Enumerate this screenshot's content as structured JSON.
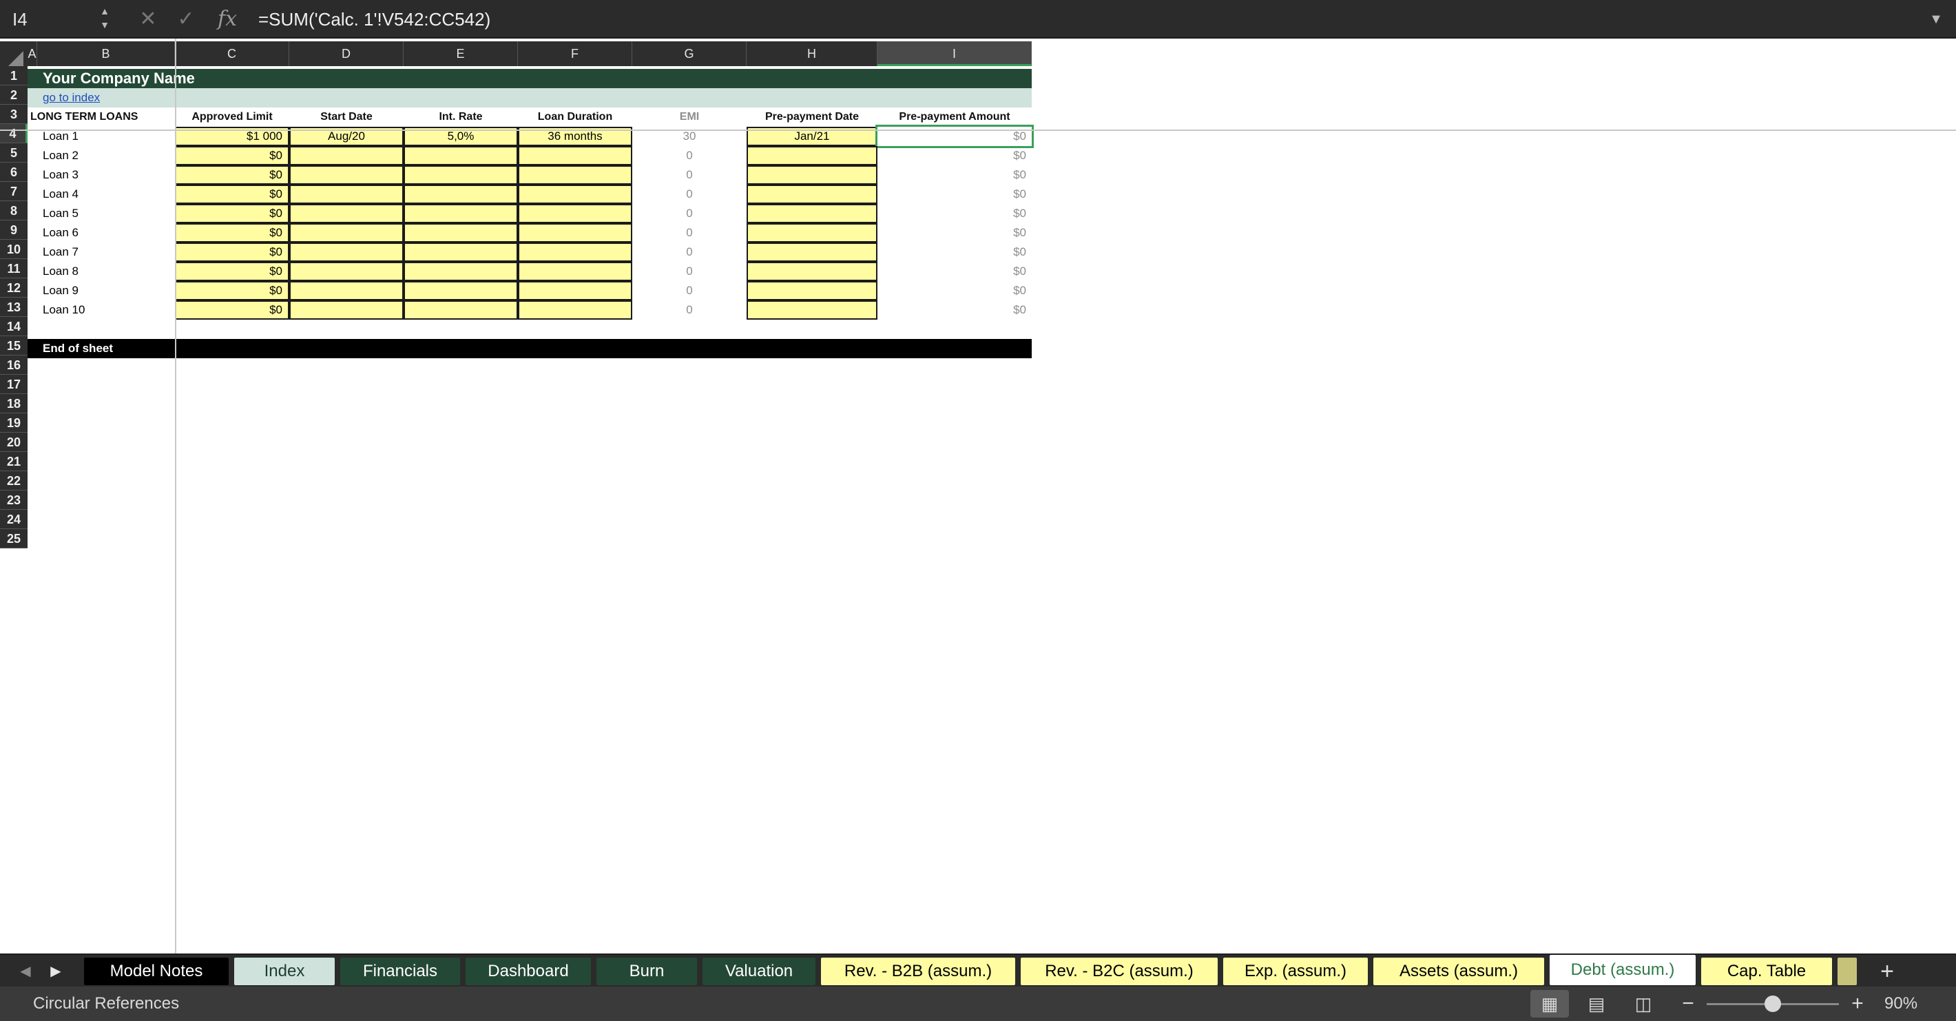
{
  "formula_bar": {
    "cell_reference": "I4",
    "formula": "=SUM('Calc. 1'!V542:CC542)",
    "name_stepper": "▲\n▼",
    "cancel_glyph": "✕",
    "confirm_glyph": "✓",
    "fx_glyph": "fx",
    "expand_glyph": "▼"
  },
  "columns": [
    "A",
    "B",
    "C",
    "D",
    "E",
    "F",
    "G",
    "H",
    "I"
  ],
  "rows": [
    "1",
    "2",
    "3",
    "4",
    "5",
    "6",
    "7",
    "8",
    "9",
    "10",
    "11",
    "12",
    "13",
    "14",
    "15",
    "16",
    "17",
    "18",
    "19",
    "20",
    "21",
    "22",
    "23",
    "24",
    "25"
  ],
  "sheet": {
    "company_name": "Your Company Name",
    "index_link": "go to index",
    "section_title": "LONG TERM LOANS",
    "headers": {
      "approved_limit": "Approved Limit",
      "start_date": "Start Date",
      "int_rate": "Int. Rate",
      "loan_duration": "Loan Duration",
      "emi": "EMI",
      "prepayment_date": "Pre-payment Date",
      "prepayment_amount": "Pre-payment Amount"
    },
    "loans": [
      {
        "name": "Loan 1",
        "approved_limit": "$1 000",
        "start_date": "Aug/20",
        "int_rate": "5,0%",
        "loan_duration": "36 months",
        "emi": "30",
        "prepayment_date": "Jan/21",
        "prepayment_amount": "$0"
      },
      {
        "name": "Loan 2",
        "approved_limit": "$0",
        "start_date": "",
        "int_rate": "",
        "loan_duration": "",
        "emi": "0",
        "prepayment_date": "",
        "prepayment_amount": "$0"
      },
      {
        "name": "Loan 3",
        "approved_limit": "$0",
        "start_date": "",
        "int_rate": "",
        "loan_duration": "",
        "emi": "0",
        "prepayment_date": "",
        "prepayment_amount": "$0"
      },
      {
        "name": "Loan 4",
        "approved_limit": "$0",
        "start_date": "",
        "int_rate": "",
        "loan_duration": "",
        "emi": "0",
        "prepayment_date": "",
        "prepayment_amount": "$0"
      },
      {
        "name": "Loan 5",
        "approved_limit": "$0",
        "start_date": "",
        "int_rate": "",
        "loan_duration": "",
        "emi": "0",
        "prepayment_date": "",
        "prepayment_amount": "$0"
      },
      {
        "name": "Loan 6",
        "approved_limit": "$0",
        "start_date": "",
        "int_rate": "",
        "loan_duration": "",
        "emi": "0",
        "prepayment_date": "",
        "prepayment_amount": "$0"
      },
      {
        "name": "Loan 7",
        "approved_limit": "$0",
        "start_date": "",
        "int_rate": "",
        "loan_duration": "",
        "emi": "0",
        "prepayment_date": "",
        "prepayment_amount": "$0"
      },
      {
        "name": "Loan 8",
        "approved_limit": "$0",
        "start_date": "",
        "int_rate": "",
        "loan_duration": "",
        "emi": "0",
        "prepayment_date": "",
        "prepayment_amount": "$0"
      },
      {
        "name": "Loan 9",
        "approved_limit": "$0",
        "start_date": "",
        "int_rate": "",
        "loan_duration": "",
        "emi": "0",
        "prepayment_date": "",
        "prepayment_amount": "$0"
      },
      {
        "name": "Loan 10",
        "approved_limit": "$0",
        "start_date": "",
        "int_rate": "",
        "loan_duration": "",
        "emi": "0",
        "prepayment_date": "",
        "prepayment_amount": "$0"
      }
    ],
    "end_of_sheet": "End of sheet",
    "selected_cell": "I4"
  },
  "tabs": [
    {
      "label": "Model Notes",
      "bg": "#000000",
      "fg": "#ffffff",
      "active": false
    },
    {
      "label": "Index",
      "bg": "#cfe2dc",
      "fg": "#1e3d30",
      "active": false
    },
    {
      "label": "Financials",
      "bg": "#244836",
      "fg": "#ffffff",
      "active": false
    },
    {
      "label": "Dashboard",
      "bg": "#244836",
      "fg": "#ffffff",
      "active": false
    },
    {
      "label": "Burn",
      "bg": "#244836",
      "fg": "#ffffff",
      "active": false
    },
    {
      "label": "Valuation",
      "bg": "#244836",
      "fg": "#ffffff",
      "active": false
    },
    {
      "label": "Rev. - B2B (assum.)",
      "bg": "#fffca2",
      "fg": "#000000",
      "active": false
    },
    {
      "label": "Rev. - B2C (assum.)",
      "bg": "#fffca2",
      "fg": "#000000",
      "active": false
    },
    {
      "label": "Exp. (assum.)",
      "bg": "#fffca2",
      "fg": "#000000",
      "active": false
    },
    {
      "label": "Assets (assum.)",
      "bg": "#fffca2",
      "fg": "#000000",
      "active": false
    },
    {
      "label": "Debt (assum.)",
      "bg": "#ffffff",
      "fg": "#2f7a4a",
      "active": true
    },
    {
      "label": "Cap. Table",
      "bg": "#fffca2",
      "fg": "#000000",
      "active": false
    }
  ],
  "tab_nav": {
    "prev": "◀",
    "next": "▶",
    "add": "+"
  },
  "status_bar": {
    "status_text": "Circular References",
    "zoom_level": "90%",
    "zoom_fraction": 0.5,
    "zoom_out": "−",
    "zoom_in": "+",
    "view_normal": "▦",
    "view_layout": "▤",
    "view_break": "◫"
  },
  "colors": {
    "dark_green": "#244836",
    "light_teal": "#cfe2dc",
    "input_yellow": "#fffca2",
    "selection_green": "#3aa05a",
    "link_blue": "#1f4fbf"
  }
}
